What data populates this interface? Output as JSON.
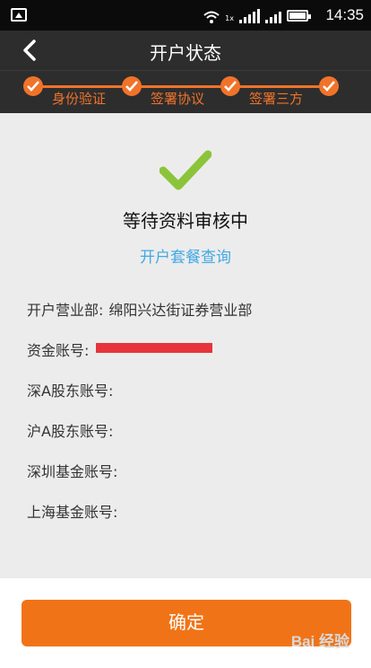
{
  "status_bar": {
    "time": "14:35",
    "network_label": "1x"
  },
  "header": {
    "title": "开户状态"
  },
  "steps": [
    {
      "label": "身份验证"
    },
    {
      "label": "签署协议"
    },
    {
      "label": "签署三方"
    }
  ],
  "main": {
    "status_title": "等待资料审核中",
    "package_link": "开户套餐查询",
    "info": [
      {
        "label": "开户营业部:",
        "value": "绵阳兴达街证券营业部"
      },
      {
        "label": "资金账号:",
        "value": ""
      },
      {
        "label": "深A股东账号:",
        "value": ""
      },
      {
        "label": "沪A股东账号:",
        "value": ""
      },
      {
        "label": "深圳基金账号:",
        "value": ""
      },
      {
        "label": "上海基金账号:",
        "value": ""
      }
    ]
  },
  "footer": {
    "confirm_label": "确定"
  },
  "watermark": {
    "text": "Bai 经验"
  },
  "colors": {
    "accent": "#f0732a",
    "check": "#8bc43a",
    "link": "#41a9e4",
    "button": "#f07417"
  }
}
